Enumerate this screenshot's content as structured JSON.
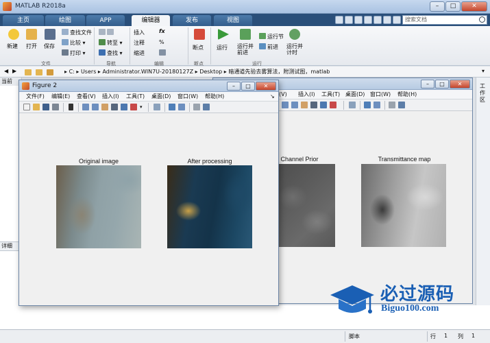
{
  "app": {
    "title": "MATLAB R2018a"
  },
  "window_controls": {
    "minimize": "–",
    "maximize": "□",
    "close": "✕"
  },
  "tabs": [
    {
      "label": "主页"
    },
    {
      "label": "绘图"
    },
    {
      "label": "APP"
    },
    {
      "label": "编辑器",
      "active": true
    },
    {
      "label": "发布"
    },
    {
      "label": "视图"
    }
  ],
  "search": {
    "placeholder": "搜索文档"
  },
  "ribbon": {
    "file": {
      "new": "新建",
      "open": "打开",
      "save": "保存",
      "find_file": "查找文件",
      "compare": "比较",
      "print": "打印",
      "group": "文件"
    },
    "navigate": {
      "goto": "转至",
      "find": "查找",
      "group": "导航"
    },
    "edit": {
      "insert": "插入",
      "comment": "注释",
      "indent": "缩进",
      "fx": "fx",
      "group": "编辑"
    },
    "breakpoints": {
      "label": "断点",
      "group": "断点"
    },
    "run": {
      "run": "运行",
      "run_advance": "运行并\n前进",
      "run_section": "运行节",
      "advance": "前进",
      "run_time": "运行并\n计时",
      "group": "运行"
    }
  },
  "addressbar": {
    "path": [
      "C:",
      "Users",
      "Administrator.WIN7U-20180127Z",
      "Desktop",
      "暗通道先验去雾算法，附测试图，matlab"
    ]
  },
  "left_panel": {
    "header": "当前",
    "detail": "详细"
  },
  "right_strip": {
    "label": "工作区"
  },
  "statusbar": {
    "script": "脚本",
    "row_label": "行",
    "row": "1",
    "col_label": "列",
    "col": "1"
  },
  "figure_back": {
    "menu": [
      "(V)",
      "插入(I)",
      "工具(T)",
      "桌面(D)",
      "窗口(W)",
      "帮助(H)"
    ]
  },
  "figure2": {
    "title": "Figure 2",
    "menu": [
      "文件(F)",
      "编辑(E)",
      "查看(V)",
      "插入(I)",
      "工具(T)",
      "桌面(D)",
      "窗口(W)",
      "帮助(H)"
    ]
  },
  "axes_titles": {
    "original": "Original image",
    "processed": "After processing",
    "dark_channel": "Channel Prior",
    "transmittance": "Transmittance map"
  },
  "watermark": {
    "cn": "必过源码",
    "en": "Biguo100.com"
  },
  "colors": {
    "tab_bar": "#2a4f7a",
    "accent": "#1a5fb4",
    "close_button": "#c5452c"
  }
}
